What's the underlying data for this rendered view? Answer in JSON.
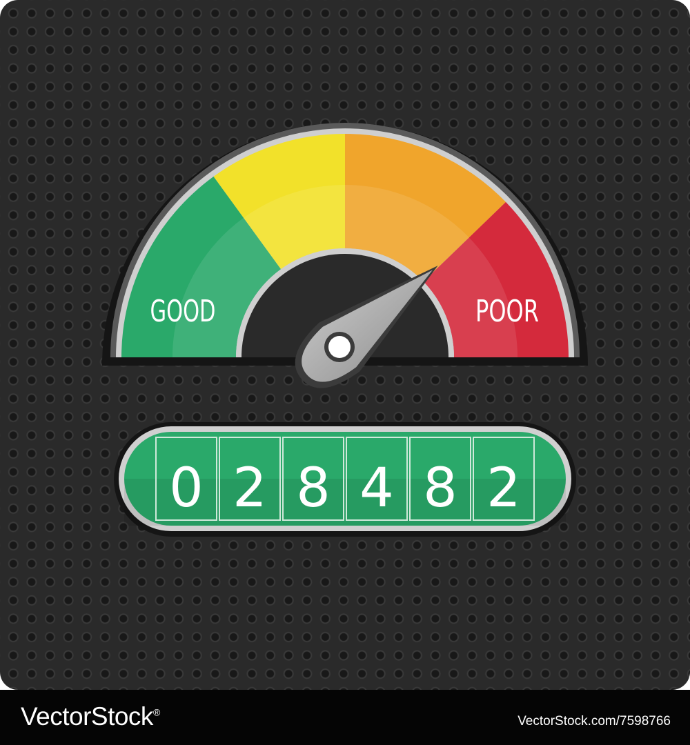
{
  "gauge": {
    "left_label": "GOOD",
    "right_label": "POOR",
    "segments": [
      {
        "name": "green",
        "color": "#2aa96a"
      },
      {
        "name": "yellow",
        "color": "#f2e12a"
      },
      {
        "name": "orange",
        "color": "#f0a52c"
      },
      {
        "name": "red",
        "color": "#d42a3c"
      }
    ],
    "needle_level": 0.78
  },
  "counter": {
    "digits": [
      "0",
      "2",
      "8",
      "4",
      "8",
      "2"
    ],
    "color": "#2aa96a"
  },
  "footer": {
    "brand": "VectorStock",
    "brand_mark": "®",
    "image_id": "VectorStock.com/7598766"
  }
}
